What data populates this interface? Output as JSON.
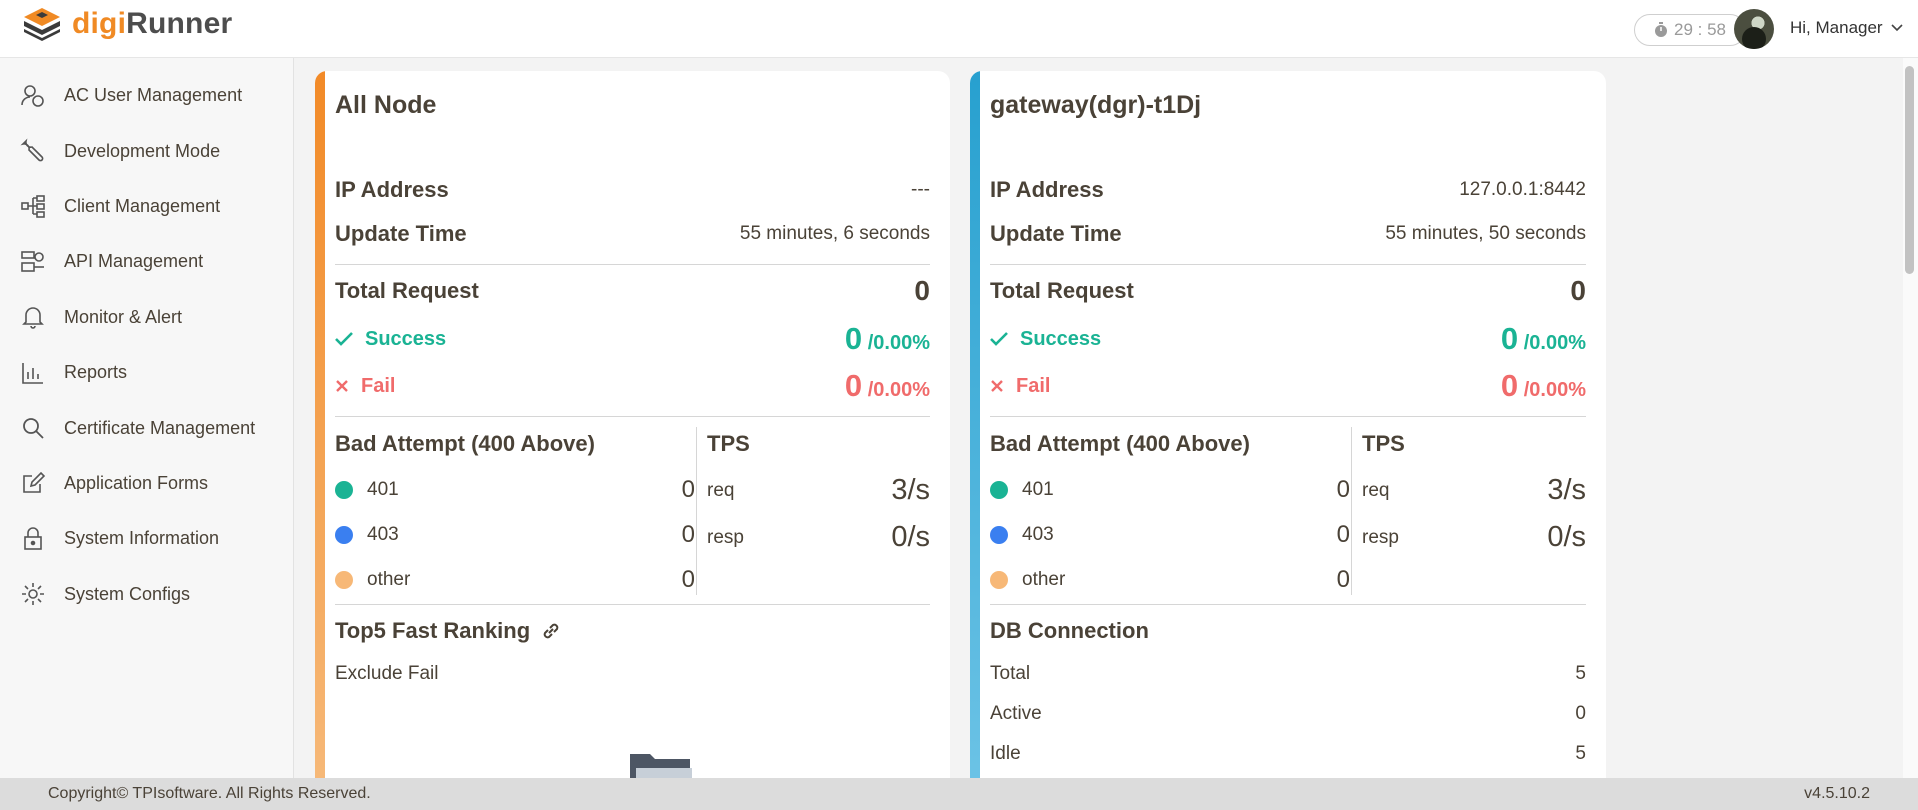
{
  "brand": {
    "part1": "digi",
    "part2": "Runner"
  },
  "header": {
    "timer": "29 : 58",
    "greeting": "Hi, Manager"
  },
  "sidebar": {
    "items": [
      {
        "label": "AC User Management",
        "icon": "users-icon"
      },
      {
        "label": "Development Mode",
        "icon": "wrench-icon"
      },
      {
        "label": "Client Management",
        "icon": "hierarchy-icon"
      },
      {
        "label": "API Management",
        "icon": "api-icon"
      },
      {
        "label": "Monitor & Alert",
        "icon": "bell-icon"
      },
      {
        "label": "Reports",
        "icon": "bar-chart-icon"
      },
      {
        "label": "Certificate Management",
        "icon": "search-icon"
      },
      {
        "label": "Application Forms",
        "icon": "edit-icon"
      },
      {
        "label": "System Information",
        "icon": "lock-icon"
      },
      {
        "label": "System Configs",
        "icon": "gear-icon"
      }
    ]
  },
  "cards": [
    {
      "title": "All Node",
      "ip_label": "IP Address",
      "ip": "---",
      "update_label": "Update Time",
      "update": "55 minutes, 6 seconds",
      "total_label": "Total Request",
      "total": "0",
      "success_label": "Success",
      "success_count": "0",
      "success_pct": "/0.00%",
      "fail_label": "Fail",
      "fail_count": "0",
      "fail_pct": "/0.00%",
      "bad_title": "Bad Attempt (400 Above)",
      "bad": [
        {
          "code": "401",
          "value": "0",
          "color": "#1ab394"
        },
        {
          "code": "403",
          "value": "0",
          "color": "#3a7ff0"
        },
        {
          "code": "other",
          "value": "0",
          "color": "#f7b877"
        }
      ],
      "tps_title": "TPS",
      "tps": [
        {
          "label": "req",
          "value": "3/s"
        },
        {
          "label": "resp",
          "value": "0/s"
        }
      ],
      "section_title": "Top5 Fast Ranking",
      "section_sub": "Exclude Fail"
    },
    {
      "title": "gateway(dgr)-t1Dj",
      "ip_label": "IP Address",
      "ip": "127.0.0.1:8442",
      "update_label": "Update Time",
      "update": "55 minutes, 50 seconds",
      "total_label": "Total Request",
      "total": "0",
      "success_label": "Success",
      "success_count": "0",
      "success_pct": "/0.00%",
      "fail_label": "Fail",
      "fail_count": "0",
      "fail_pct": "/0.00%",
      "bad_title": "Bad Attempt (400 Above)",
      "bad": [
        {
          "code": "401",
          "value": "0",
          "color": "#1ab394"
        },
        {
          "code": "403",
          "value": "0",
          "color": "#3a7ff0"
        },
        {
          "code": "other",
          "value": "0",
          "color": "#f7b877"
        }
      ],
      "tps_title": "TPS",
      "tps": [
        {
          "label": "req",
          "value": "3/s"
        },
        {
          "label": "resp",
          "value": "0/s"
        }
      ],
      "db_title": "DB Connection",
      "db": [
        {
          "label": "Total",
          "value": "5"
        },
        {
          "label": "Active",
          "value": "0"
        },
        {
          "label": "Idle",
          "value": "5"
        }
      ]
    }
  ],
  "footer": {
    "copyright": "Copyright© TPIsoftware. All Rights Reserved.",
    "version": "v4.5.10.2"
  }
}
